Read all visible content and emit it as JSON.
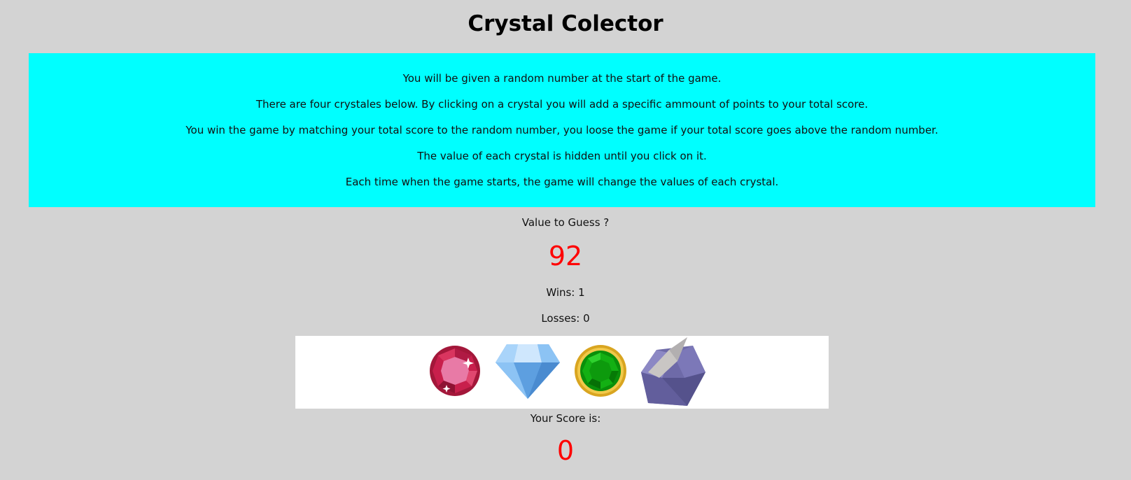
{
  "title": "Crystal Colector",
  "instructions": [
    "You will be given a random number at the start of the game.",
    "There are four crystales below. By clicking on a crystal you will add a specific ammount of points to your total score.",
    "You win the game by matching your total score to the random number, you loose the game if your total score goes above the random number.",
    "The value of each crystal is hidden until you click on it.",
    "Each time when the game starts, the game will change the values of each crystal."
  ],
  "target": {
    "label": "Value to Guess ?",
    "value": "92"
  },
  "stats": {
    "wins_label": "Wins: 1",
    "losses_label": "Losses: 0"
  },
  "crystals": [
    {
      "name": "ruby-crystal-icon"
    },
    {
      "name": "diamond-crystal-icon"
    },
    {
      "name": "emerald-crystal-icon"
    },
    {
      "name": "amethyst-crystal-icon"
    }
  ],
  "score": {
    "label": "Your Score is:",
    "value": "0"
  },
  "colors": {
    "background": "#d3d3d3",
    "instructions_bg": "#00ffff",
    "number_color": "#ff0000"
  }
}
